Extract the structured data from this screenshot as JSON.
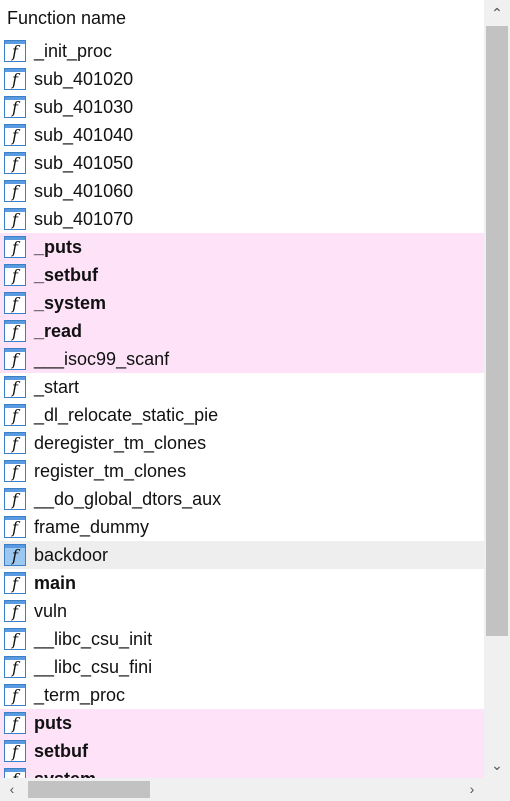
{
  "header": {
    "title": "Function name"
  },
  "icons": {
    "function": "function-f-icon"
  },
  "colors": {
    "imported_row": "#fde2f8",
    "selected_row": "#eeeeee"
  },
  "functions": [
    {
      "name": "_init_proc",
      "bold": false,
      "imported": false,
      "selected": false
    },
    {
      "name": "sub_401020",
      "bold": false,
      "imported": false,
      "selected": false
    },
    {
      "name": "sub_401030",
      "bold": false,
      "imported": false,
      "selected": false
    },
    {
      "name": "sub_401040",
      "bold": false,
      "imported": false,
      "selected": false
    },
    {
      "name": "sub_401050",
      "bold": false,
      "imported": false,
      "selected": false
    },
    {
      "name": "sub_401060",
      "bold": false,
      "imported": false,
      "selected": false
    },
    {
      "name": "sub_401070",
      "bold": false,
      "imported": false,
      "selected": false
    },
    {
      "name": "_puts",
      "bold": true,
      "imported": true,
      "selected": false
    },
    {
      "name": "_setbuf",
      "bold": true,
      "imported": true,
      "selected": false
    },
    {
      "name": "_system",
      "bold": true,
      "imported": true,
      "selected": false
    },
    {
      "name": "_read",
      "bold": true,
      "imported": true,
      "selected": false
    },
    {
      "name": "___isoc99_scanf",
      "bold": false,
      "imported": true,
      "selected": false
    },
    {
      "name": "_start",
      "bold": false,
      "imported": false,
      "selected": false
    },
    {
      "name": "_dl_relocate_static_pie",
      "bold": false,
      "imported": false,
      "selected": false
    },
    {
      "name": "deregister_tm_clones",
      "bold": false,
      "imported": false,
      "selected": false
    },
    {
      "name": "register_tm_clones",
      "bold": false,
      "imported": false,
      "selected": false
    },
    {
      "name": "__do_global_dtors_aux",
      "bold": false,
      "imported": false,
      "selected": false
    },
    {
      "name": "frame_dummy",
      "bold": false,
      "imported": false,
      "selected": false
    },
    {
      "name": "backdoor",
      "bold": false,
      "imported": false,
      "selected": true
    },
    {
      "name": "main",
      "bold": true,
      "imported": false,
      "selected": false
    },
    {
      "name": "vuln",
      "bold": false,
      "imported": false,
      "selected": false
    },
    {
      "name": "__libc_csu_init",
      "bold": false,
      "imported": false,
      "selected": false
    },
    {
      "name": "__libc_csu_fini",
      "bold": false,
      "imported": false,
      "selected": false
    },
    {
      "name": "_term_proc",
      "bold": false,
      "imported": false,
      "selected": false
    },
    {
      "name": "puts",
      "bold": true,
      "imported": true,
      "selected": false
    },
    {
      "name": "setbuf",
      "bold": true,
      "imported": true,
      "selected": false
    },
    {
      "name": "system",
      "bold": true,
      "imported": true,
      "selected": false
    }
  ],
  "scrollbars": {
    "vertical": {
      "up_icon": "scroll-up-arrow-icon",
      "down_icon": "scroll-down-arrow-icon"
    },
    "horizontal": {
      "left_icon": "scroll-left-arrow-icon",
      "right_icon": "scroll-right-arrow-icon"
    }
  }
}
